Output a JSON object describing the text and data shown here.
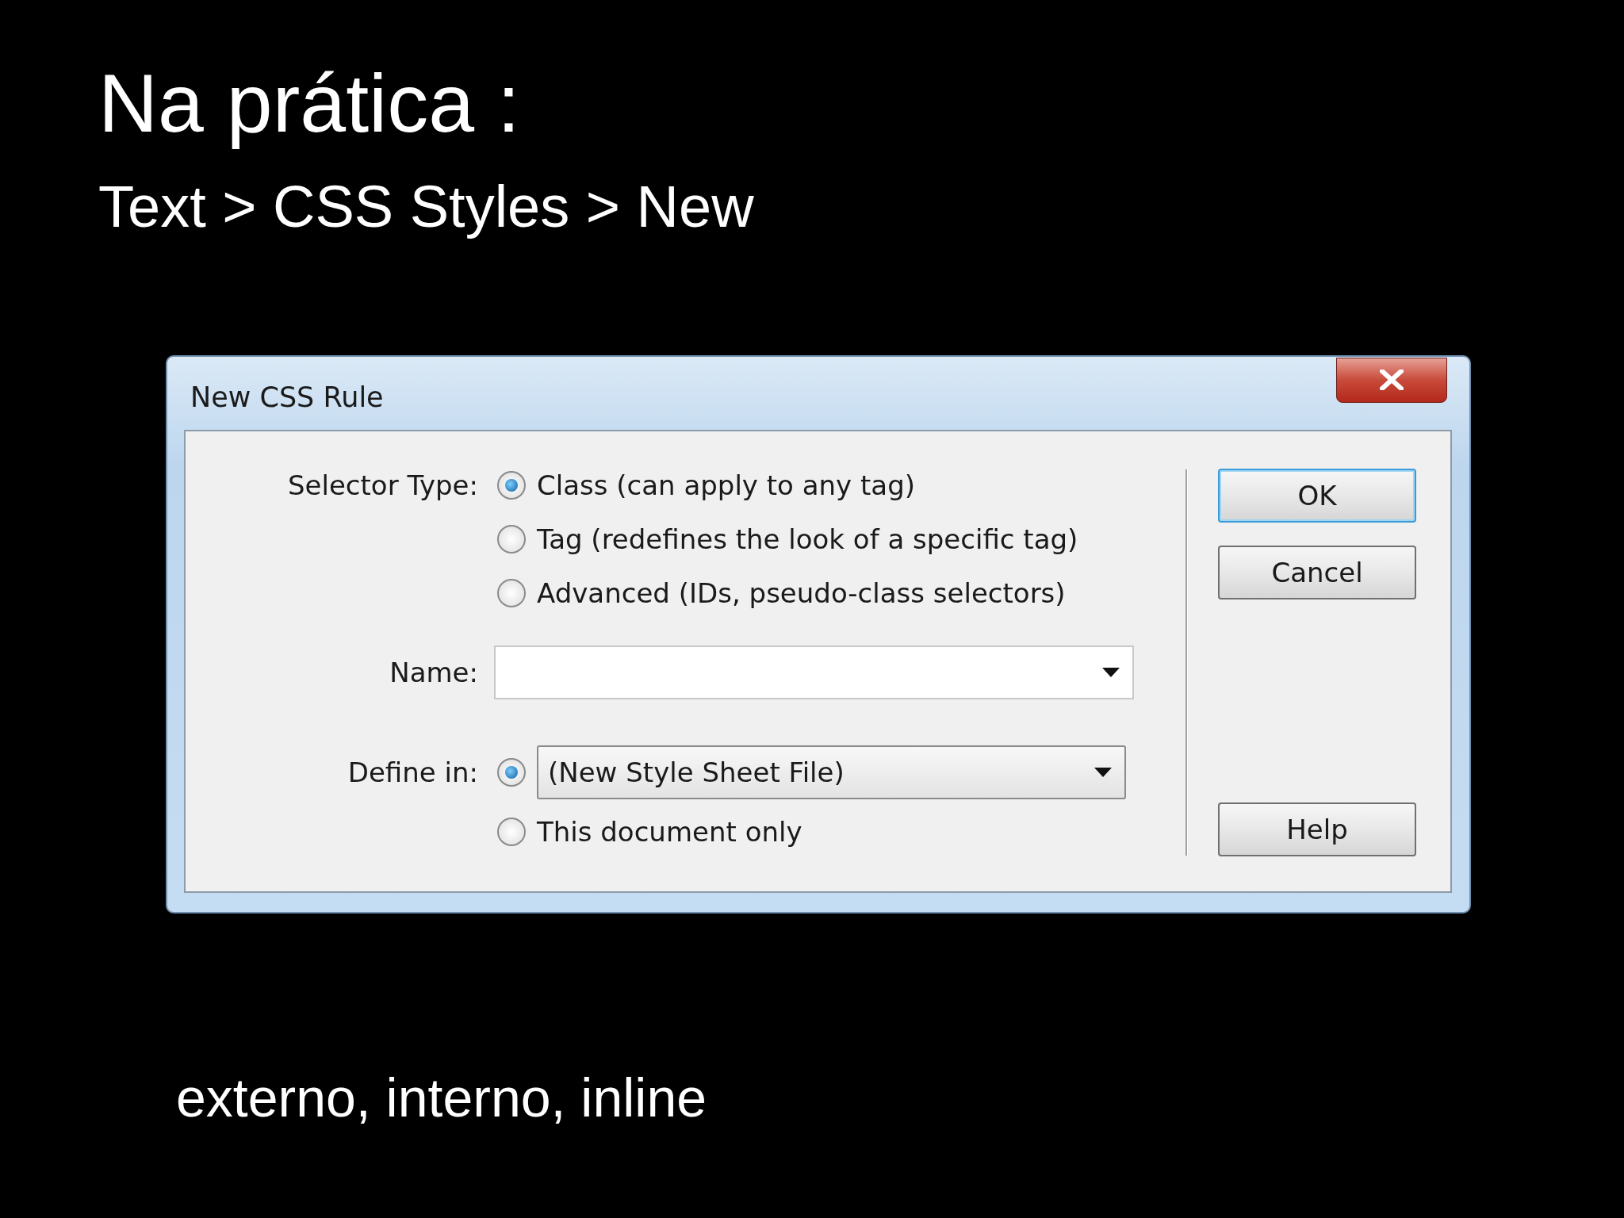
{
  "slide": {
    "title": "Na prática :",
    "subtitle": "Text > CSS Styles > New",
    "footer": "externo, interno, inline"
  },
  "dialog": {
    "title": "New CSS Rule",
    "selector_type": {
      "label": "Selector Type:",
      "options": [
        {
          "label": "Class (can apply to any tag)",
          "selected": true
        },
        {
          "label": "Tag (redefines the look of a specific tag)",
          "selected": false
        },
        {
          "label": "Advanced (IDs, pseudo-class selectors)",
          "selected": false
        }
      ]
    },
    "name": {
      "label": "Name:"
    },
    "define_in": {
      "label": "Define in:",
      "options": [
        {
          "kind": "select",
          "value": "(New Style Sheet File)",
          "selected": true
        },
        {
          "kind": "text",
          "label": "This document only",
          "selected": false
        }
      ]
    },
    "buttons": [
      {
        "label": "OK",
        "default": true
      },
      {
        "label": "Cancel",
        "default": false
      },
      {
        "label": "Help",
        "default": false
      }
    ]
  }
}
